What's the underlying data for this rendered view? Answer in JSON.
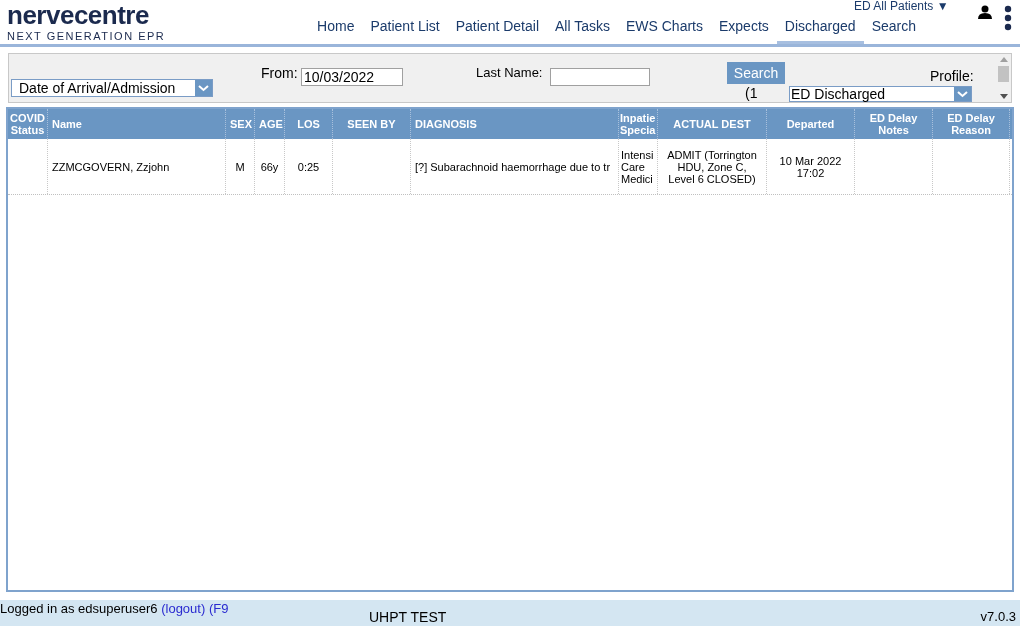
{
  "logo": {
    "name": "nervecentre",
    "tagline": "NEXT GENERATION EPR"
  },
  "nav": [
    {
      "label": "Home",
      "selected": false
    },
    {
      "label": "Patient List",
      "selected": false
    },
    {
      "label": "Patient Detail",
      "selected": false
    },
    {
      "label": "All Tasks",
      "selected": false
    },
    {
      "label": "EWS Charts",
      "selected": false
    },
    {
      "label": "Expects",
      "selected": false
    },
    {
      "label": "Discharged",
      "selected": true
    },
    {
      "label": "Search",
      "selected": false
    }
  ],
  "ward_selector": "ED All Patients ▼",
  "filters": {
    "date_type": "Date of Arrival/Admission",
    "from_label": "From:",
    "from_value": "10/03/2022",
    "last_name_label": "Last Name:",
    "search_button": "Search",
    "count": "(1",
    "profile_label": "Profile:",
    "profile_value": "ED Discharged"
  },
  "table": {
    "columns": [
      {
        "label": "COVID Status"
      },
      {
        "label": "Name"
      },
      {
        "label": "SEX"
      },
      {
        "label": "AGE"
      },
      {
        "label": "LOS"
      },
      {
        "label": "SEEN BY"
      },
      {
        "label": "DIAGNOSIS"
      },
      {
        "label": "Inpatie Specia"
      },
      {
        "label": "ACTUAL DEST"
      },
      {
        "label": "Departed"
      },
      {
        "label": "ED Delay Notes"
      },
      {
        "label": "ED Delay Reason"
      }
    ],
    "rows": [
      {
        "cells": [
          "",
          "ZZMCGOVERN, Zzjohn",
          "M",
          "66y",
          "0:25",
          "",
          "[?] Subarachnoid haemorrhage due to tr",
          "Intensi Care Medici",
          "ADMIT (Torrington HDU, Zone C, Level 6 CLOSED)",
          "10 Mar 2022 17:02",
          "",
          ""
        ]
      }
    ]
  },
  "status_bar": {
    "user": "Logged in as edsuperuser6",
    "logout": "(logout)",
    "lock": "(F9",
    "environment": "UHPT TEST",
    "version": "v7.0.3"
  }
}
